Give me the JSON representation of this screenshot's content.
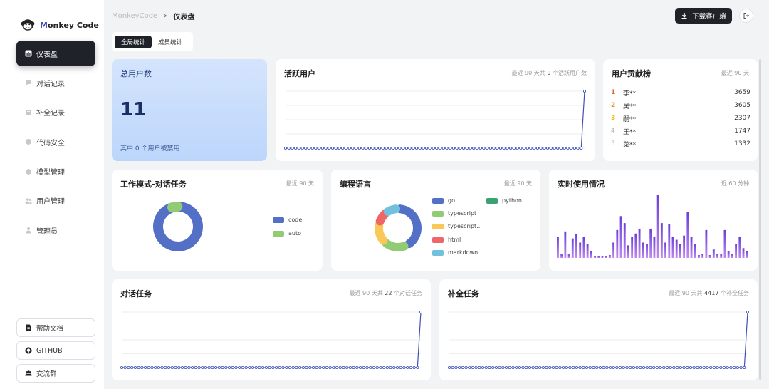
{
  "app": {
    "name_m": "M",
    "name_rest": "onkey Code"
  },
  "sidebar": {
    "items": [
      {
        "label": "仪表盘",
        "icon": "bar-chart-icon",
        "active": true
      },
      {
        "label": "对话记录",
        "icon": "chat-bubble-icon"
      },
      {
        "label": "补全记录",
        "icon": "document-icon"
      },
      {
        "label": "代码安全",
        "icon": "shield-icon"
      },
      {
        "label": "模型管理",
        "icon": "cube-icon"
      },
      {
        "label": "用户管理",
        "icon": "users-icon"
      },
      {
        "label": "管理员",
        "icon": "admin-icon"
      }
    ],
    "links": [
      {
        "label": "帮助文档",
        "icon": "doc-icon"
      },
      {
        "label": "GITHUB",
        "icon": "github-icon"
      },
      {
        "label": "交流群",
        "icon": "group-icon"
      }
    ]
  },
  "header": {
    "breadcrumb_root": "MonkeyCode",
    "breadcrumb_sep": "›",
    "breadcrumb_current": "仪表盘",
    "download_label": "下载客户端"
  },
  "tabs": [
    {
      "label": "全局统计",
      "active": true
    },
    {
      "label": "成员统计"
    }
  ],
  "total_users": {
    "title": "总用户数",
    "value": "11",
    "sub": "其中 0 个用户被禁用"
  },
  "active_users": {
    "title": "活跃用户",
    "meta_prefix": "最近 90 天共",
    "meta_num": "9",
    "meta_suffix": "个活跃用户数"
  },
  "ranking": {
    "title": "用户贡献榜",
    "meta": "最近 90 天",
    "rows": [
      {
        "rank": "1",
        "name": "李**",
        "value": "3659",
        "color": "#e8633a"
      },
      {
        "rank": "2",
        "name": "吴**",
        "value": "3605",
        "color": "#f08a24"
      },
      {
        "rank": "3",
        "name": "嗣**",
        "value": "2307",
        "color": "#f5b400"
      },
      {
        "rank": "4",
        "name": "王**",
        "value": "1747",
        "color": "#aaaaaa"
      },
      {
        "rank": "5",
        "name": "菜**",
        "value": "1332",
        "color": "#aaaaaa"
      }
    ]
  },
  "work_mode": {
    "title": "工作模式-对话任务",
    "meta": "最近 90 天",
    "legend": [
      {
        "name": "code",
        "color": "#5470c6"
      },
      {
        "name": "auto",
        "color": "#91cc75"
      }
    ],
    "chart_data": {
      "type": "pie",
      "categories": [
        "code",
        "auto"
      ],
      "values": [
        95,
        5
      ]
    }
  },
  "languages": {
    "title": "编程语言",
    "meta": "最近 90 天",
    "legend": [
      {
        "name": "go",
        "color": "#5470c6"
      },
      {
        "name": "python",
        "color": "#3ba272"
      },
      {
        "name": "typescript",
        "color": "#91cc75"
      },
      {
        "name": "typescript...",
        "color": "#fac858"
      },
      {
        "name": "html",
        "color": "#ee6666"
      },
      {
        "name": "markdown",
        "color": "#73c0de"
      }
    ],
    "chart_data": {
      "type": "pie",
      "categories": [
        "go",
        "python",
        "typescript",
        "typescript...",
        "html",
        "markdown"
      ],
      "values": [
        40,
        1,
        18,
        16,
        10,
        10
      ]
    }
  },
  "realtime": {
    "title": "实时使用情况",
    "meta": "近 60 分钟",
    "chart_data": {
      "type": "bar",
      "values": [
        30,
        5,
        38,
        5,
        28,
        34,
        22,
        30,
        20,
        10,
        2,
        2,
        2,
        2,
        4,
        22,
        40,
        60,
        50,
        18,
        30,
        35,
        42,
        22,
        20,
        42,
        30,
        90,
        50,
        22,
        48,
        30,
        26,
        20,
        32,
        66,
        30,
        20,
        4,
        6,
        40,
        4,
        12,
        6,
        5,
        40,
        10,
        6,
        20,
        30,
        14,
        10
      ]
    }
  },
  "chat_tasks": {
    "title": "对话任务",
    "meta_prefix": "最近 90 天共",
    "meta_num": "22",
    "meta_suffix": "个对话任务"
  },
  "completion_tasks": {
    "title": "补全任务",
    "meta_prefix": "最近 90 天共",
    "meta_num": "4417",
    "meta_suffix": "个补全任务"
  },
  "chart_data": [
    {
      "type": "line",
      "name": "active_users_daily",
      "x_count": 90,
      "values_note_last": 9
    },
    {
      "type": "line",
      "name": "chat_tasks_daily",
      "x_count": 90,
      "values_note_last": 22
    },
    {
      "type": "line",
      "name": "completion_tasks_daily",
      "x_count": 90,
      "values_note_last": 4417
    }
  ]
}
